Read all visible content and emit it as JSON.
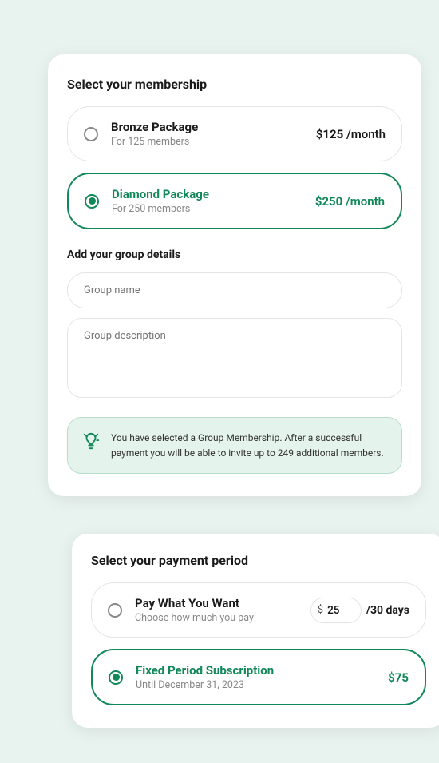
{
  "membership": {
    "title": "Select your membership",
    "options": [
      {
        "name": "Bronze Package",
        "desc": "For 125 members",
        "price": "$125",
        "period": "/month"
      },
      {
        "name": "Diamond Package",
        "desc": "For 250 members",
        "price": "$250",
        "period": "/month"
      }
    ]
  },
  "groupDetails": {
    "title": "Add your group details",
    "namePlaceholder": "Group name",
    "descPlaceholder": "Group description"
  },
  "info": {
    "text": "You have selected a Group Membership. After a successful payment you will be able to invite up to 249 additional members."
  },
  "payment": {
    "title": "Select your payment period",
    "options": [
      {
        "name": "Pay What You Want",
        "desc": "Choose how much you pay!",
        "currency": "$",
        "amount": "25",
        "period": "/30 days"
      },
      {
        "name": "Fixed Period Subscription",
        "desc": "Until December 31, 2023",
        "price": "$75"
      }
    ]
  }
}
